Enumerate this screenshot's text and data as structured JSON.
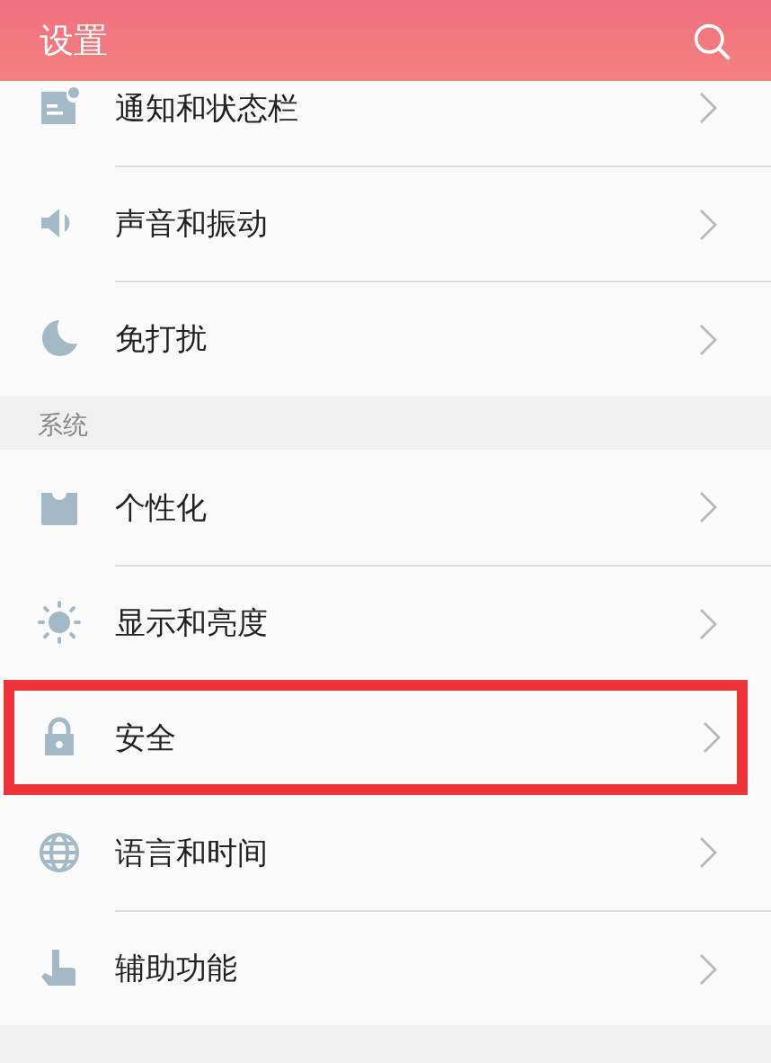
{
  "header": {
    "title": "设置"
  },
  "groups": [
    {
      "items": [
        {
          "kind": "notice",
          "label": "通知和状态栏",
          "highlighted": false
        },
        {
          "kind": "sound",
          "label": "声音和振动",
          "highlighted": false
        },
        {
          "kind": "moon",
          "label": "免打扰",
          "highlighted": false
        }
      ]
    },
    {
      "title": "系统",
      "items": [
        {
          "kind": "shirt",
          "label": "个性化",
          "highlighted": false
        },
        {
          "kind": "sun",
          "label": "显示和亮度",
          "highlighted": false
        },
        {
          "kind": "lock",
          "label": "安全",
          "highlighted": true
        },
        {
          "kind": "globe",
          "label": "语言和时间",
          "highlighted": false
        },
        {
          "kind": "hand",
          "label": "辅助功能",
          "highlighted": false
        }
      ]
    }
  ]
}
